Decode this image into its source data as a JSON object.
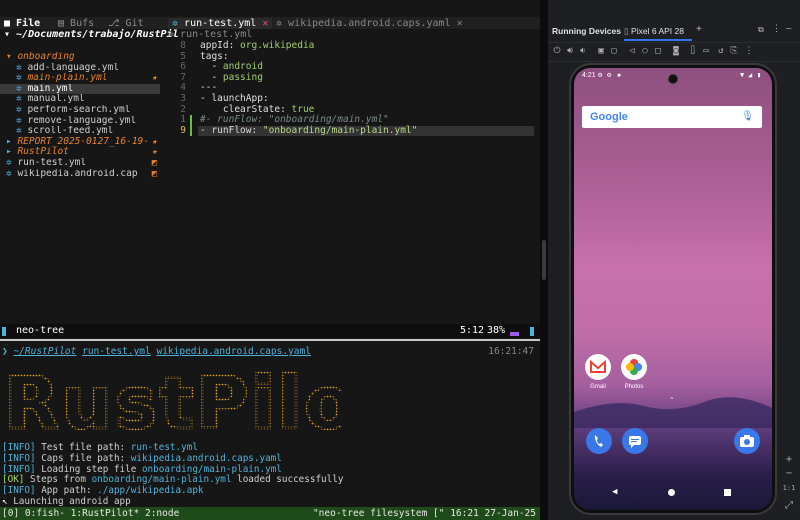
{
  "editor_tabs": {
    "file_tab": "File",
    "bufs_tab": "Bufs",
    "git_tab": "Git",
    "active_tab": "run-test.yml",
    "inactive_tab": "wikipedia.android.caps.yaml"
  },
  "neo_tree": {
    "root": "~/Documents/trabajo/RustPil",
    "items": [
      {
        "name": "onboarding",
        "type": "folder-open",
        "mark": ""
      },
      {
        "name": "add-language.yml",
        "type": "file",
        "mark": ""
      },
      {
        "name": "main-plain.yml",
        "type": "file-modified",
        "mark": "★"
      },
      {
        "name": "main.yml",
        "type": "file-selected",
        "mark": ""
      },
      {
        "name": "manual.yml",
        "type": "file",
        "mark": ""
      },
      {
        "name": "perform-search.yml",
        "type": "file",
        "mark": ""
      },
      {
        "name": "remove-language.yml",
        "type": "file",
        "mark": ""
      },
      {
        "name": "scroll-feed.yml",
        "type": "file",
        "mark": ""
      },
      {
        "name": "REPORT_2025-0127_16-19-",
        "type": "folder-modified",
        "mark": "★"
      },
      {
        "name": "RustPilot",
        "type": "folder-modified",
        "mark": "★"
      },
      {
        "name": "run-test.yml",
        "type": "file",
        "mark": "◩"
      },
      {
        "name": "wikipedia.android.cap",
        "type": "file",
        "mark": "◩"
      }
    ]
  },
  "buffer_name": "run-test.yml",
  "code_lines": [
    {
      "num": "8",
      "text": "appId: ",
      "val": "org.wikipedia"
    },
    {
      "num": "5",
      "text": "tags:",
      "val": ""
    },
    {
      "num": "6",
      "text": "  - ",
      "val": "android"
    },
    {
      "num": "7",
      "text": "  - ",
      "val": "passing"
    },
    {
      "num": "4",
      "text": "---",
      "val": ""
    },
    {
      "num": "3",
      "text": "- launchApp:",
      "val": ""
    },
    {
      "num": "2",
      "text": "    clearState: ",
      "val": "true"
    },
    {
      "num": "1",
      "text": "#- runFlow: \"onboarding/main.yml\"",
      "val": ""
    },
    {
      "num": "9",
      "text": "- runFlow: ",
      "val": "\"onboarding/main-plain.yml\""
    }
  ],
  "statusline": {
    "left": "neo-tree",
    "position": "5:12",
    "percent": "38%"
  },
  "prompt": {
    "path": "~/RustPilot",
    "arg1": "run-test.yml",
    "arg2": "wikipedia.android.caps.yaml",
    "time": "16:21:47"
  },
  "log_lines": [
    {
      "tag": "[INFO]",
      "text": " Test file path: ",
      "hl": "run-test.yml",
      "rest": ""
    },
    {
      "tag": "[INFO]",
      "text": " Caps file path: ",
      "hl": "wikipedia.android.caps.yaml",
      "rest": ""
    },
    {
      "tag": "[INFO]",
      "text": " Loading step file ",
      "hl": "onboarding/main-plain.yml",
      "rest": ""
    },
    {
      "tag": "[OK]",
      "text": " Steps from ",
      "hl": "onboarding/main-plain.yml",
      "rest": " loaded successfully"
    },
    {
      "tag": "[INFO]",
      "text": " App path: ",
      "hl": "./app/wikipedia.apk",
      "rest": ""
    },
    {
      "tag": "↖",
      "text": " Launching android app",
      "hl": "",
      "rest": ""
    }
  ],
  "tmux": {
    "left": "[0] 0:fish- 1:RustPilot* 2:node",
    "right": "\"neo-tree filesystem [\" 16:21 27-Jan-25"
  },
  "studio": {
    "title": "Running Devices",
    "device_tab": "Pixel 6 API 28",
    "zoom_label": "1:1"
  },
  "phone": {
    "clock": "4:21",
    "search_logo": "Google",
    "apps": [
      {
        "label": "Gmail",
        "icon": "gmail-icon"
      },
      {
        "label": "Photos",
        "icon": "photos-icon"
      }
    ],
    "dock": [
      "phone-icon",
      "messages-icon",
      "camera-icon"
    ]
  },
  "colors": {
    "accent_blue": "#4fb3d9",
    "modified_orange": "#e8832a",
    "tmux_green": "#1f4a1a",
    "ascii_orange": "#e0a020"
  }
}
